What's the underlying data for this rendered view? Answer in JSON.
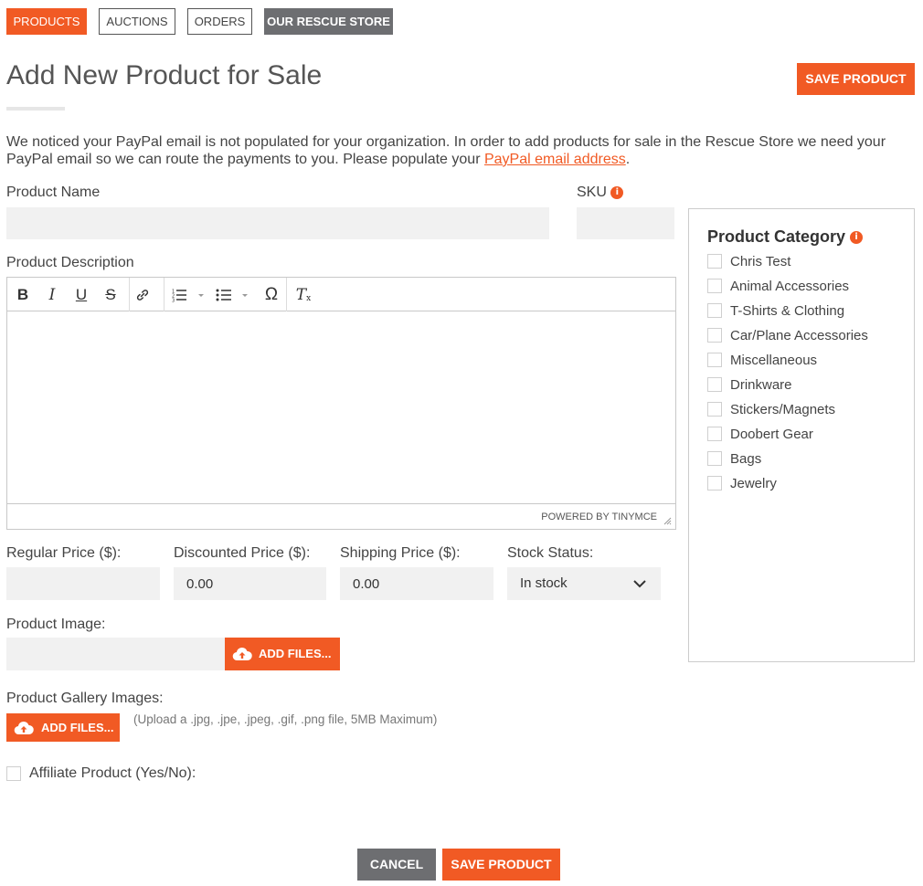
{
  "nav": {
    "tabs": [
      {
        "label": "PRODUCTS"
      },
      {
        "label": "AUCTIONS"
      },
      {
        "label": "ORDERS"
      },
      {
        "label": "OUR RESCUE STORE"
      }
    ]
  },
  "header": {
    "title": "Add New Product for Sale",
    "save_label": "SAVE PRODUCT"
  },
  "notice": {
    "text": "We noticed your PayPal email is not populated for your organization. In order to add products for sale in the Rescue Store we need your PayPal email so we can route the payments to you. Please populate your ",
    "link": "PayPal email address",
    "end": "."
  },
  "form": {
    "product_name_label": "Product Name",
    "product_name_value": "",
    "sku_label": "SKU",
    "sku_value": "",
    "description_label": "Product Description",
    "editor_status": "POWERED BY TINYMCE",
    "regular_price_label": "Regular Price ($):",
    "regular_price_value": "",
    "discounted_price_label": "Discounted Price ($):",
    "discounted_price_value": "0.00",
    "shipping_price_label": "Shipping Price ($):",
    "shipping_price_value": "0.00",
    "stock_status_label": "Stock Status:",
    "stock_status_value": "In stock",
    "product_image_label": "Product Image:",
    "add_files_label": "ADD FILES...",
    "gallery_label": "Product Gallery Images:",
    "gallery_add_files_label": "ADD FILES...",
    "gallery_hint": "(Upload a .jpg, .jpe, .jpeg, .gif, .png file, 5MB Maximum)",
    "affiliate_label": "Affiliate Product (Yes/No):"
  },
  "category": {
    "title": "Product Category",
    "items": [
      {
        "label": "Chris Test"
      },
      {
        "label": "Animal Accessories"
      },
      {
        "label": "T-Shirts & Clothing"
      },
      {
        "label": "Car/Plane Accessories"
      },
      {
        "label": "Miscellaneous"
      },
      {
        "label": "Drinkware"
      },
      {
        "label": "Stickers/Magnets"
      },
      {
        "label": "Doobert Gear"
      },
      {
        "label": "Bags"
      },
      {
        "label": "Jewelry"
      }
    ]
  },
  "footer": {
    "cancel_label": "CANCEL",
    "save_label": "SAVE PRODUCT"
  },
  "colors": {
    "accent": "#f15a24",
    "dark_button": "#6d6e71",
    "field_bg": "#f1f1f1"
  }
}
